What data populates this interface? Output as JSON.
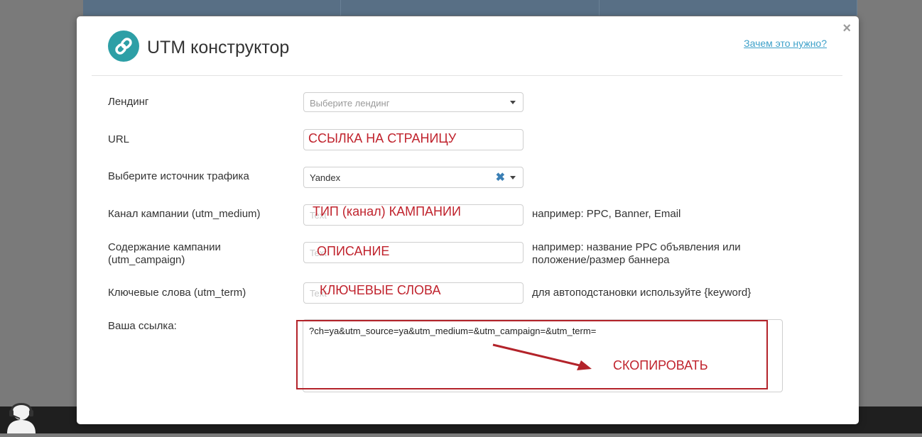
{
  "modal": {
    "title": "UTM конструктор",
    "help_link": "Зачем это нужно?",
    "close_symbol": "×"
  },
  "form": {
    "landing": {
      "label": "Лендинг",
      "placeholder": "Выберите лендинг",
      "annotation": ""
    },
    "url": {
      "label": "URL",
      "placeholder": "",
      "annotation": "ССЫЛКА НА СТРАНИЦУ"
    },
    "source": {
      "label": "Выберите источник трафика",
      "value": "Yandex",
      "clear_symbol": "✖"
    },
    "medium": {
      "label": "Канал кампании (utm_medium)",
      "placeholder": "Text",
      "annotation": "ТИП (канал) КАМПАНИИ",
      "hint": "например: PPC, Banner, Email"
    },
    "campaign": {
      "label_line1": "Содержание кампании",
      "label_line2": "(utm_campaign)",
      "placeholder": "Text",
      "annotation": "ОПИСАНИЕ",
      "hint_line1": "например: название PPC объявления или",
      "hint_line2": "положение/размер баннера"
    },
    "term": {
      "label": "Ключевые слова (utm_term)",
      "placeholder": "Text",
      "annotation": "КЛЮЧЕВЫЕ СЛОВА",
      "hint": "для автоподстановки используйте {keyword}"
    },
    "result": {
      "label": "Ваша ссылка:",
      "value": "?ch=ya&utm_source=ya&utm_medium=&utm_campaign=&utm_term=",
      "annotation": "СКОПИРОВАТЬ"
    }
  },
  "colors": {
    "accent": "#2d9fa6",
    "annotation": "#c0232d",
    "link": "#3da0c9"
  }
}
